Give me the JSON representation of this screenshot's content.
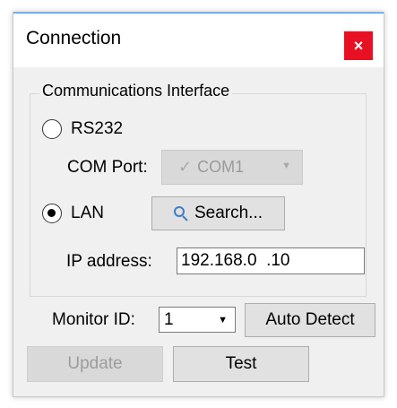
{
  "window": {
    "title": "Connection",
    "close_glyph": "×"
  },
  "interface_group": {
    "label": "Communications Interface",
    "rs232": {
      "label": "RS232",
      "selected": false
    },
    "com_port": {
      "label": "COM Port:",
      "check_glyph": "✓",
      "value": "COM1",
      "enabled": false
    },
    "lan": {
      "label": "LAN",
      "selected": true
    },
    "search_button": {
      "label": "Search..."
    },
    "ip_address": {
      "label": "IP address:",
      "value": "192.168.0  .10"
    }
  },
  "monitor": {
    "label": "Monitor ID:",
    "value": "1",
    "dropdown_glyph": "▼"
  },
  "buttons": {
    "auto_detect": "Auto Detect",
    "update": "Update",
    "test": "Test"
  },
  "colors": {
    "close_button": "#e81123",
    "title_accent": "#1e90ff",
    "dialog_bg": "#f0f0f0"
  }
}
